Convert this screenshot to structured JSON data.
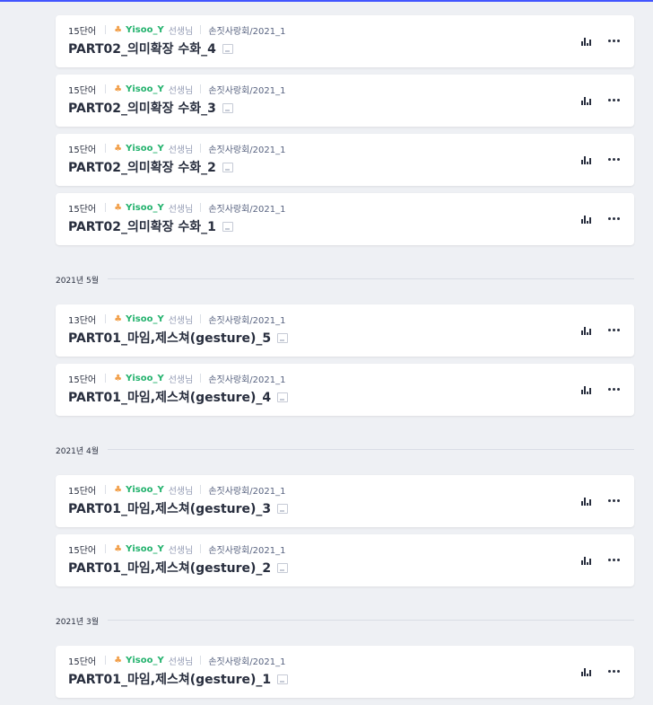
{
  "accent_color": "#4255ff",
  "user_color": "#23b26d",
  "groups": [
    {
      "date": "",
      "items": [
        {
          "count": "15단어",
          "user": "Yisoo_Y",
          "role": "선생님",
          "folder": "손짓사랑회/2021_1",
          "title": "PART02_의미확장 수화_4"
        },
        {
          "count": "15단어",
          "user": "Yisoo_Y",
          "role": "선생님",
          "folder": "손짓사랑회/2021_1",
          "title": "PART02_의미확장 수화_3"
        },
        {
          "count": "15단어",
          "user": "Yisoo_Y",
          "role": "선생님",
          "folder": "손짓사랑회/2021_1",
          "title": "PART02_의미확장 수화_2"
        },
        {
          "count": "15단어",
          "user": "Yisoo_Y",
          "role": "선생님",
          "folder": "손짓사랑회/2021_1",
          "title": "PART02_의미확장 수화_1"
        }
      ]
    },
    {
      "date": "2021년 5월",
      "items": [
        {
          "count": "13단어",
          "user": "Yisoo_Y",
          "role": "선생님",
          "folder": "손짓사랑회/2021_1",
          "title": "PART01_마임,제스쳐(gesture)_5"
        },
        {
          "count": "15단어",
          "user": "Yisoo_Y",
          "role": "선생님",
          "folder": "손짓사랑회/2021_1",
          "title": "PART01_마임,제스쳐(gesture)_4"
        }
      ]
    },
    {
      "date": "2021년 4월",
      "items": [
        {
          "count": "15단어",
          "user": "Yisoo_Y",
          "role": "선생님",
          "folder": "손짓사랑회/2021_1",
          "title": "PART01_마임,제스쳐(gesture)_3"
        },
        {
          "count": "15단어",
          "user": "Yisoo_Y",
          "role": "선생님",
          "folder": "손짓사랑회/2021_1",
          "title": "PART01_마임,제스쳐(gesture)_2"
        }
      ]
    },
    {
      "date": "2021년 3월",
      "items": [
        {
          "count": "15단어",
          "user": "Yisoo_Y",
          "role": "선생님",
          "folder": "손짓사랑회/2021_1",
          "title": "PART01_마임,제스쳐(gesture)_1"
        }
      ]
    }
  ],
  "icons": {
    "stats": "bar-chart-icon",
    "more": "more-horizontal-icon",
    "image": "image-icon",
    "avatar": "avatar-icon"
  }
}
